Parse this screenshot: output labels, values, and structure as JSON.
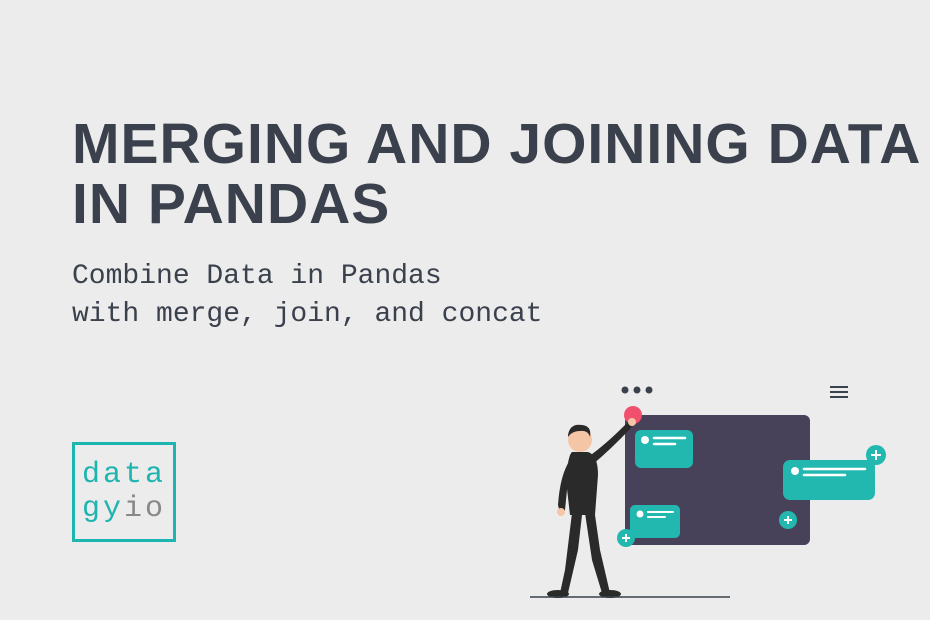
{
  "title": "MERGING AND JOINING DATA IN PANDAS",
  "subtitle_line1": "Combine Data in Pandas",
  "subtitle_line2": "with merge, join, and concat",
  "logo": {
    "line1": "data",
    "gy": "gy",
    "io": "io"
  }
}
